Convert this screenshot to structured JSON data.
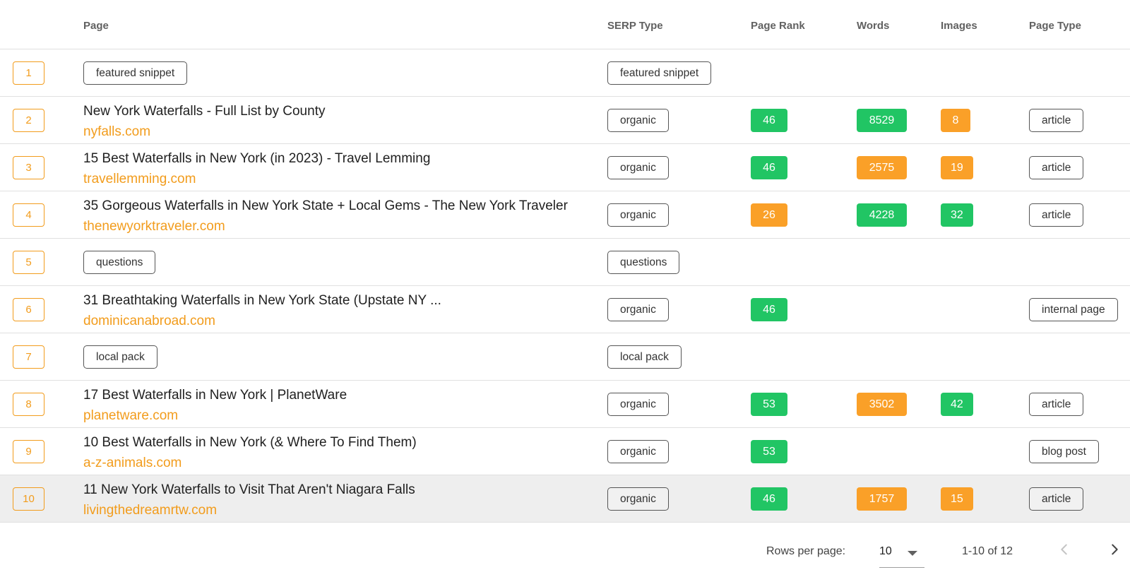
{
  "columns": {
    "page": "Page",
    "serp_type": "SERP Type",
    "page_rank": "Page Rank",
    "words": "Words",
    "images": "Images",
    "page_type": "Page Type"
  },
  "colors": {
    "accent": "#f29c1c",
    "green": "#21c564",
    "orange": "#faa028"
  },
  "rows": [
    {
      "position": "1",
      "page_chip": "featured snippet",
      "serp_type": "featured snippet"
    },
    {
      "position": "2",
      "title": "New York Waterfalls - Full List by County",
      "domain": "nyfalls.com",
      "serp_type": "organic",
      "page_rank": "46",
      "words": "8529",
      "images": "8",
      "page_type": "article"
    },
    {
      "position": "3",
      "title": "15 Best Waterfalls in New York (in 2023) - Travel Lemming",
      "domain": "travellemming.com",
      "serp_type": "organic",
      "page_rank": "46",
      "words": "2575",
      "images": "19",
      "page_type": "article"
    },
    {
      "position": "4",
      "title": "35 Gorgeous Waterfalls in New York State + Local Gems - The New York Traveler",
      "domain": "thenewyorktraveler.com",
      "serp_type": "organic",
      "page_rank": "26",
      "words": "4228",
      "images": "32",
      "page_type": "article"
    },
    {
      "position": "5",
      "page_chip": "questions",
      "serp_type": "questions"
    },
    {
      "position": "6",
      "title": "31 Breathtaking Waterfalls in New York State (Upstate NY ...",
      "domain": "dominicanabroad.com",
      "serp_type": "organic",
      "page_rank": "46",
      "page_type": "internal page"
    },
    {
      "position": "7",
      "page_chip": "local pack",
      "serp_type": "local pack"
    },
    {
      "position": "8",
      "title": "17 Best Waterfalls in New York | PlanetWare",
      "domain": "planetware.com",
      "serp_type": "organic",
      "page_rank": "53",
      "words": "3502",
      "images": "42",
      "page_type": "article"
    },
    {
      "position": "9",
      "title": "10 Best Waterfalls in New York (& Where To Find Them)",
      "domain": "a-z-animals.com",
      "serp_type": "organic",
      "page_rank": "53",
      "page_type": "blog post"
    },
    {
      "position": "10",
      "title": "11 New York Waterfalls to Visit That Aren't Niagara Falls",
      "domain": "livingthedreamrtw.com",
      "serp_type": "organic",
      "page_rank": "46",
      "words": "1757",
      "images": "15",
      "page_type": "article"
    }
  ],
  "pagination": {
    "rows_per_page_label": "Rows per page:",
    "rows_per_page_value": "10",
    "range_text": "1-10 of 12",
    "prev_icon": "chevron-left-icon",
    "next_icon": "chevron-right-icon"
  }
}
